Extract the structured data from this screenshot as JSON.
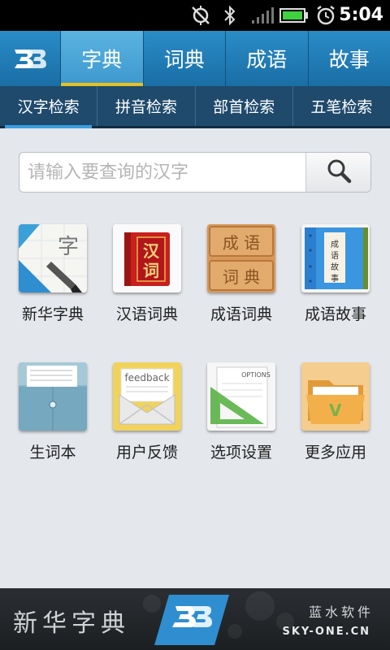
{
  "status_bar": {
    "time": "5:04",
    "icons": [
      "sync-off-icon",
      "bluetooth-icon",
      "signal-icon",
      "battery-icon",
      "alarm-icon"
    ]
  },
  "top_nav": {
    "logo": "3B",
    "tabs": [
      {
        "label": "字典",
        "active": true
      },
      {
        "label": "词典",
        "active": false
      },
      {
        "label": "成语",
        "active": false
      },
      {
        "label": "故事",
        "active": false
      }
    ]
  },
  "sub_nav": {
    "tabs": [
      {
        "label": "汉字检索",
        "active": true
      },
      {
        "label": "拼音检索",
        "active": false
      },
      {
        "label": "部首检索",
        "active": false
      },
      {
        "label": "五笔检索",
        "active": false
      }
    ]
  },
  "search": {
    "placeholder": "请输入要查询的汉字",
    "value": ""
  },
  "apps": [
    {
      "label": "新华字典",
      "icon": "xinhua-dictionary-icon"
    },
    {
      "label": "汉语词典",
      "icon": "chinese-dictionary-icon",
      "icon_text": "汉\n词"
    },
    {
      "label": "成语词典",
      "icon": "idiom-dictionary-icon",
      "icon_text_top": "成 语",
      "icon_text_bottom": "词 典"
    },
    {
      "label": "成语故事",
      "icon": "idiom-story-icon",
      "icon_text": "成语故事"
    },
    {
      "label": "生词本",
      "icon": "vocabulary-book-icon"
    },
    {
      "label": "用户反馈",
      "icon": "feedback-icon",
      "icon_text": "feedback"
    },
    {
      "label": "选项设置",
      "icon": "options-icon",
      "icon_text": "OPTIONS"
    },
    {
      "label": "更多应用",
      "icon": "more-apps-folder-icon"
    }
  ],
  "footer": {
    "title": "新华字典",
    "company": "蓝水软件",
    "site": "SKY-ONE.CN"
  },
  "colors": {
    "nav_blue": "#1a6ea6",
    "active_tab": "#4aa6d8",
    "active_underline": "#e8c020",
    "subnav": "#1f4a6c",
    "background": "#e4e7ec"
  }
}
